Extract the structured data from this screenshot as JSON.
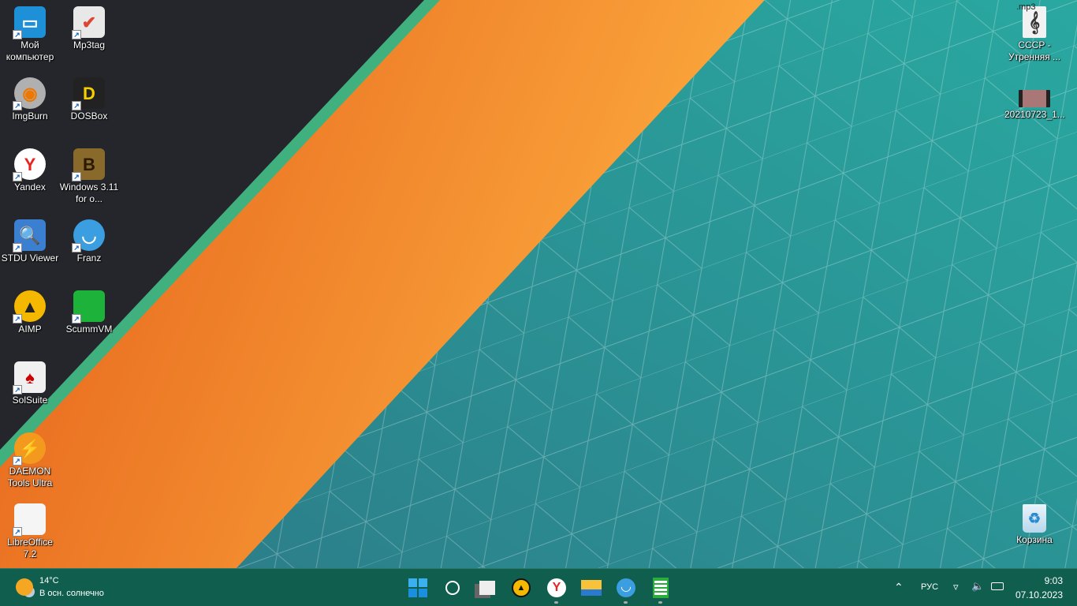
{
  "desktop": {
    "left_icons": [
      {
        "label": "Мой компьютер",
        "icon": "monitor-icon",
        "color": "#1e90d8"
      },
      {
        "label": "Mp3tag",
        "icon": "mp3tag-icon",
        "color": "#e8e8e8"
      },
      {
        "label": "ImgBurn",
        "icon": "disc-icon",
        "color": "#b0b0b0"
      },
      {
        "label": "DOSBox",
        "icon": "dosbox-icon",
        "color": "#222"
      },
      {
        "label": "Yandex",
        "icon": "yandex-icon",
        "color": "#ffffff"
      },
      {
        "label": "Windows 3.11 for o...",
        "icon": "dosbox-box-icon",
        "color": "#8a6a2a"
      },
      {
        "label": "STDU Viewer",
        "icon": "magnifier-icon",
        "color": "#3a7fd0"
      },
      {
        "label": "Franz",
        "icon": "franz-icon",
        "color": "#3a9ee0"
      },
      {
        "label": "AIMP",
        "icon": "aimp-icon",
        "color": "#f5b800"
      },
      {
        "label": "ScummVM",
        "icon": "scummvm-icon",
        "color": "#1db33a"
      },
      {
        "label": "SolSuite",
        "icon": "cards-icon",
        "color": "#f0f0f0"
      },
      {
        "label": "DAEMON Tools Ultra",
        "icon": "daemon-icon",
        "color": "#f39a1e"
      },
      {
        "label": "LibreOffice 7.2",
        "icon": "document-icon",
        "color": "#f5f5f5"
      }
    ],
    "right_icons": [
      {
        "label": "СССР - Утренняя ...",
        "icon": "mp3-file-icon",
        "badge": ".mp3"
      },
      {
        "label": "20210723_1...",
        "icon": "video-file-icon"
      },
      {
        "label": "Корзина",
        "icon": "recycle-bin-icon"
      }
    ]
  },
  "taskbar": {
    "weather": {
      "temp": "14°C",
      "desc": "В осн. солнечно"
    },
    "apps": [
      {
        "name": "start",
        "icon": "windows-start-icon",
        "running": false
      },
      {
        "name": "search",
        "icon": "search-icon",
        "running": false
      },
      {
        "name": "task-view",
        "icon": "task-view-icon",
        "running": false
      },
      {
        "name": "aimp",
        "icon": "aimp-icon",
        "running": false
      },
      {
        "name": "yandex",
        "icon": "yandex-icon",
        "running": true
      },
      {
        "name": "explorer",
        "icon": "folder-icon",
        "running": false
      },
      {
        "name": "franz",
        "icon": "franz-icon",
        "running": true
      },
      {
        "name": "libreoffice-calc",
        "icon": "calc-icon",
        "running": true
      }
    ],
    "language": "РУС",
    "time": "9:03",
    "date": "07.10.2023"
  },
  "colors": {
    "dark": "#24262b",
    "green": "#3fb07e",
    "orange1": "#e8661c",
    "orange2": "#fca83c",
    "teal1": "#2a8a92",
    "teal2": "#2bb3a2",
    "taskbar": "#105e4e"
  }
}
